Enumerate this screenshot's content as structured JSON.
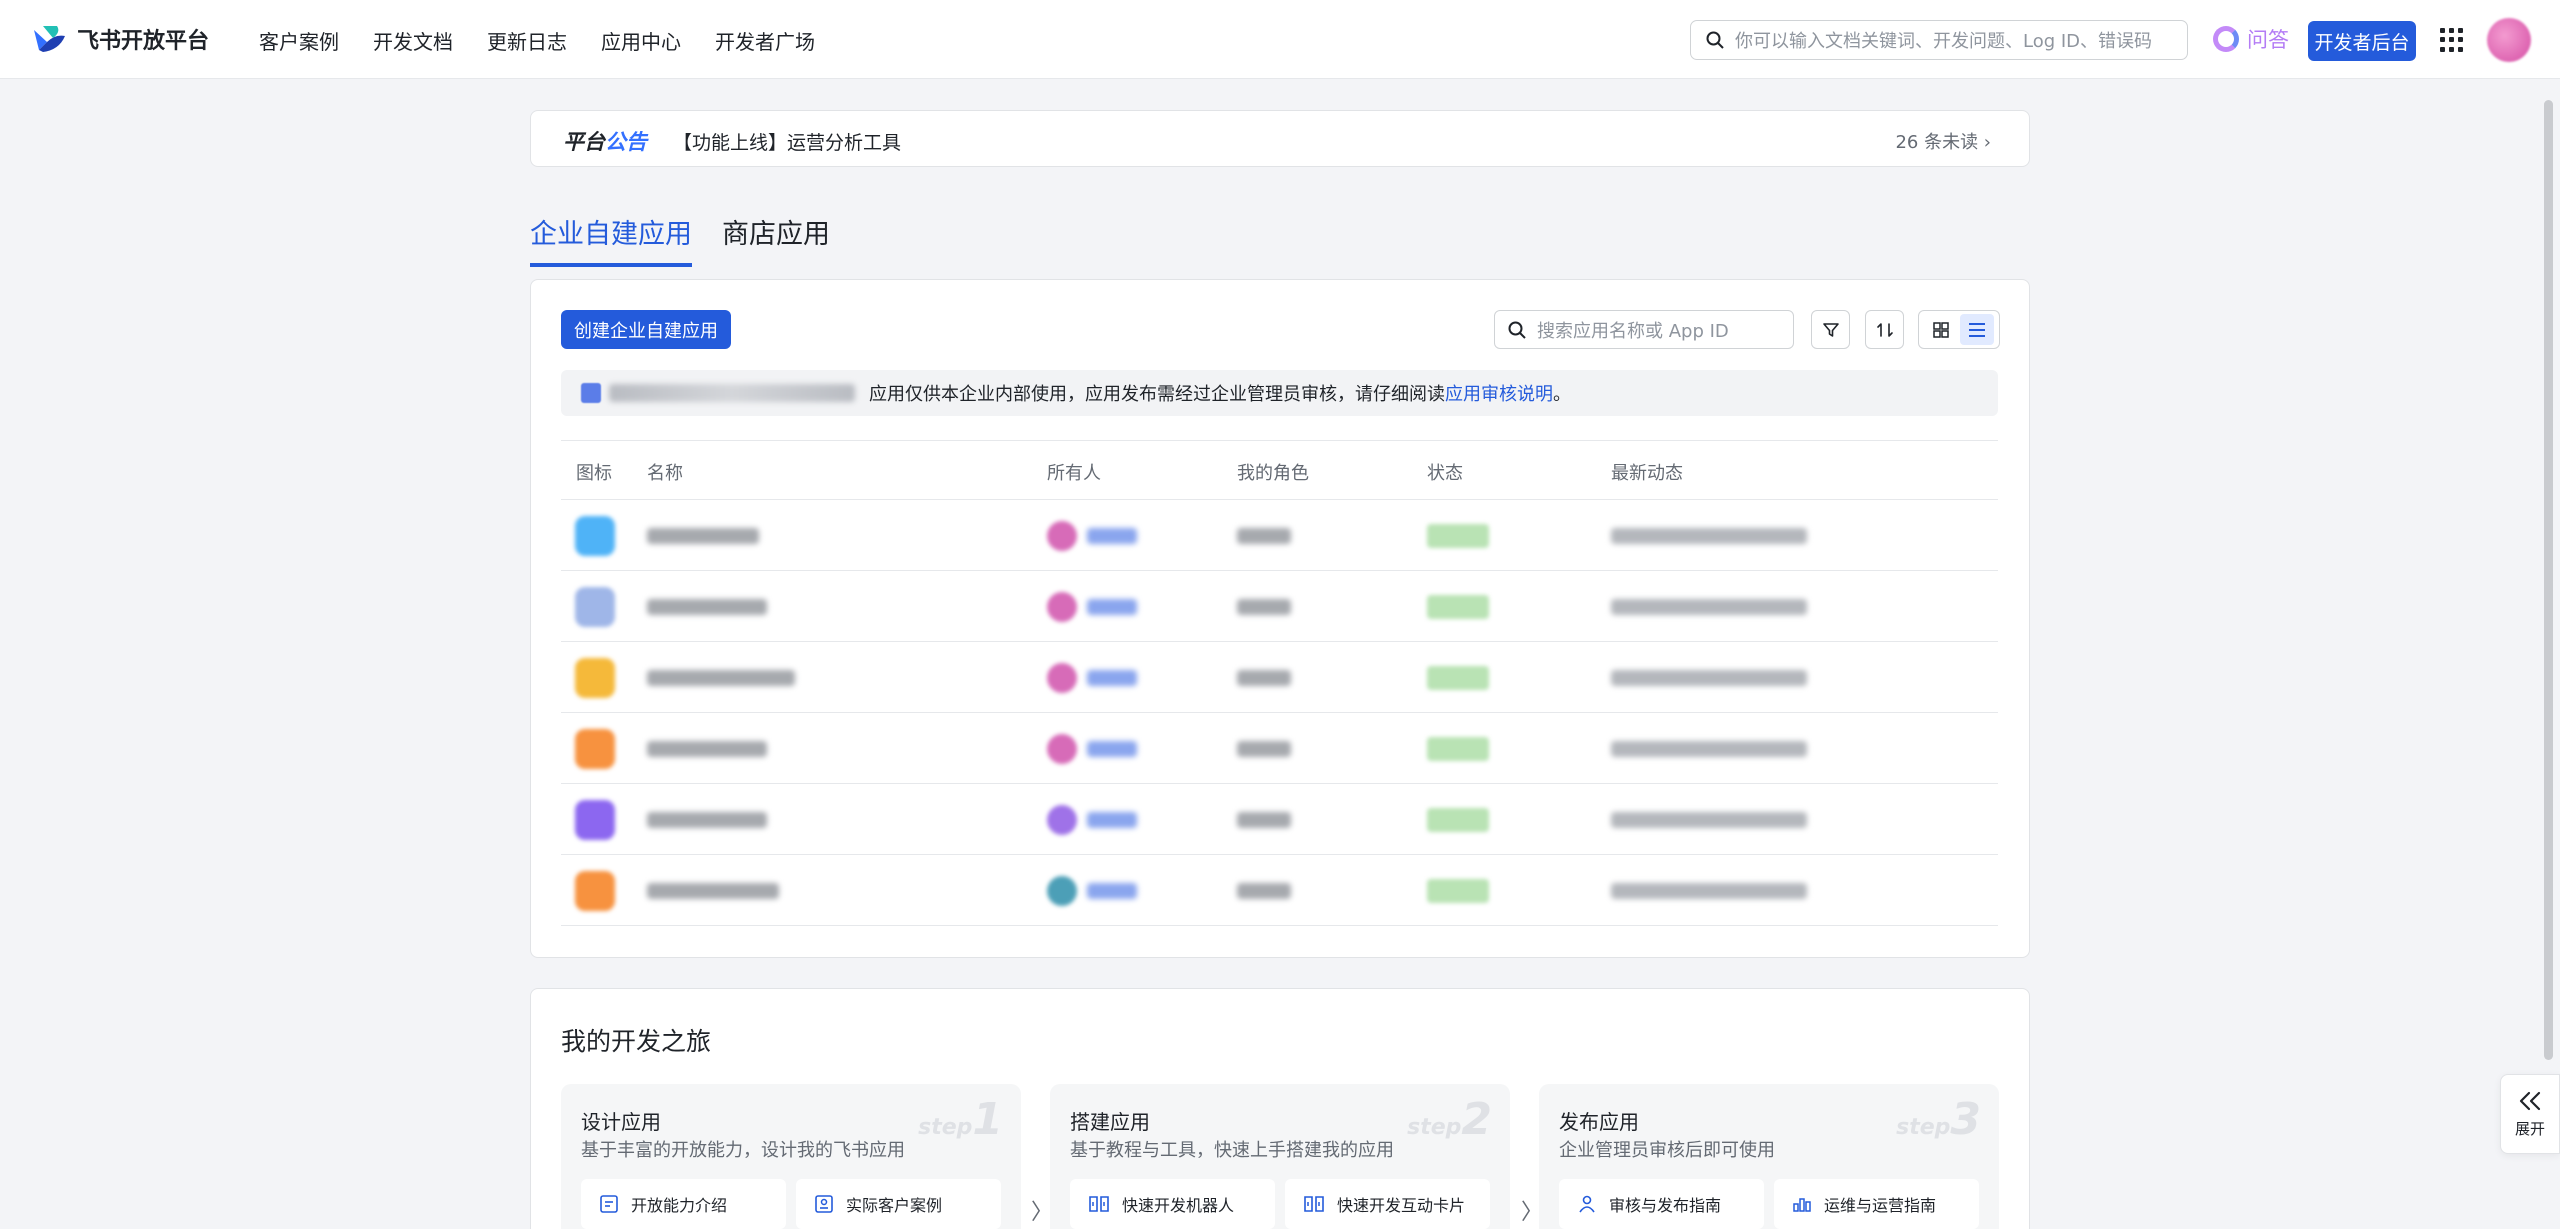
{
  "header": {
    "logo_text": "飞书开放平台",
    "nav": [
      "客户案例",
      "开发文档",
      "更新日志",
      "应用中心",
      "开发者广场"
    ],
    "search_placeholder": "你可以输入文档关键词、开发问题、Log ID、错误码",
    "ask_label": "问答",
    "dev_console_label": "开发者后台"
  },
  "notice": {
    "brand_part1": "平台",
    "brand_part2": "公告",
    "text": "【功能上线】运营分析工具",
    "unread": "26 条未读 ›"
  },
  "tabs": [
    "企业自建应用",
    "商店应用"
  ],
  "apps_panel": {
    "create_label": "创建企业自建应用",
    "search_placeholder": "搜索应用名称或 App ID",
    "info_text": "应用仅供本企业内部使用，应用发布需经过企业管理员审核，请仔细阅读 ",
    "info_link": "应用审核说明",
    "info_suffix": "。",
    "columns": [
      "图标",
      "名称",
      "所有人",
      "我的角色",
      "状态",
      "最新动态"
    ],
    "rows": [
      {
        "icon_color": "#4fb3f7",
        "owner_color": "#d76bb8",
        "name_w": 0.56
      },
      {
        "icon_color": "#9fb6e8",
        "owner_color": "#d76bb8",
        "name_w": 0.6
      },
      {
        "icon_color": "#f5b93a",
        "owner_color": "#d76bb8",
        "name_w": 0.74
      },
      {
        "icon_color": "#f7923f",
        "owner_color": "#d76bb8",
        "name_w": 0.6
      },
      {
        "icon_color": "#8c67f0",
        "owner_color": "#9f72e8",
        "name_w": 0.6
      },
      {
        "icon_color": "#f7923f",
        "owner_color": "#4c9fb7",
        "name_w": 0.66
      }
    ]
  },
  "journey": {
    "title": "我的开发之旅",
    "steps": [
      {
        "title": "设计应用",
        "desc": "基于丰富的开放能力，设计我的飞书应用",
        "wm_word": "step",
        "wm_num": "1",
        "chips": [
          "开放能力介绍",
          "实际客户案例"
        ]
      },
      {
        "title": "搭建应用",
        "desc": "基于教程与工具，快速上手搭建我的应用",
        "wm_word": "step",
        "wm_num": "2",
        "chips": [
          "快速开发机器人",
          "快速开发互动卡片"
        ]
      },
      {
        "title": "发布应用",
        "desc": "企业管理员审核后即可使用",
        "wm_word": "step",
        "wm_num": "3",
        "chips": [
          "审核与发布指南",
          "运维与运营指南"
        ]
      }
    ],
    "arrow": "〉"
  },
  "side": {
    "expand_label": "展开"
  }
}
